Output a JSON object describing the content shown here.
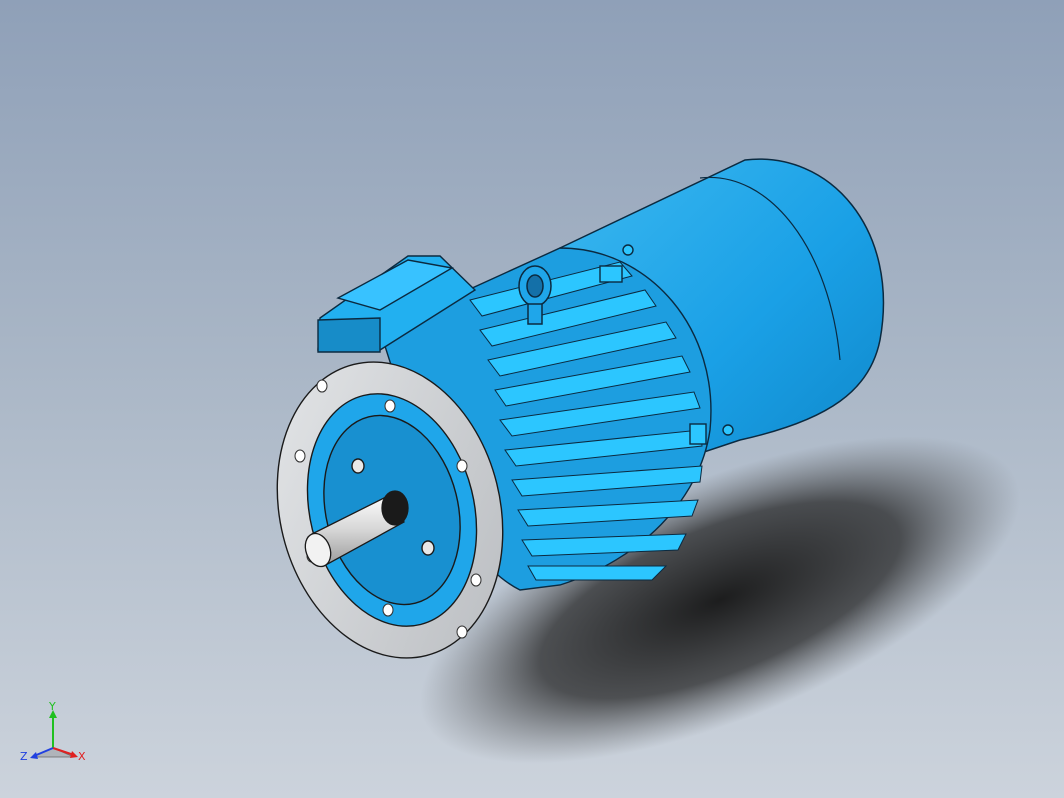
{
  "triad": {
    "x_label": "X",
    "y_label": "Y",
    "z_label": "Z",
    "x_color": "#e02020",
    "y_color": "#20c020",
    "z_color": "#2040e0"
  },
  "colors": {
    "motor_body": "#1fa6ea",
    "fin_highlight": "#28c8ff",
    "flange": "#cfd2d6",
    "shaft": "#e8e8e8",
    "shadow": "#1a1a1a",
    "outline": "#102030"
  },
  "icons": {
    "eye_bolt": "lifting-eye-icon",
    "triad": "coordinate-triad-icon"
  }
}
